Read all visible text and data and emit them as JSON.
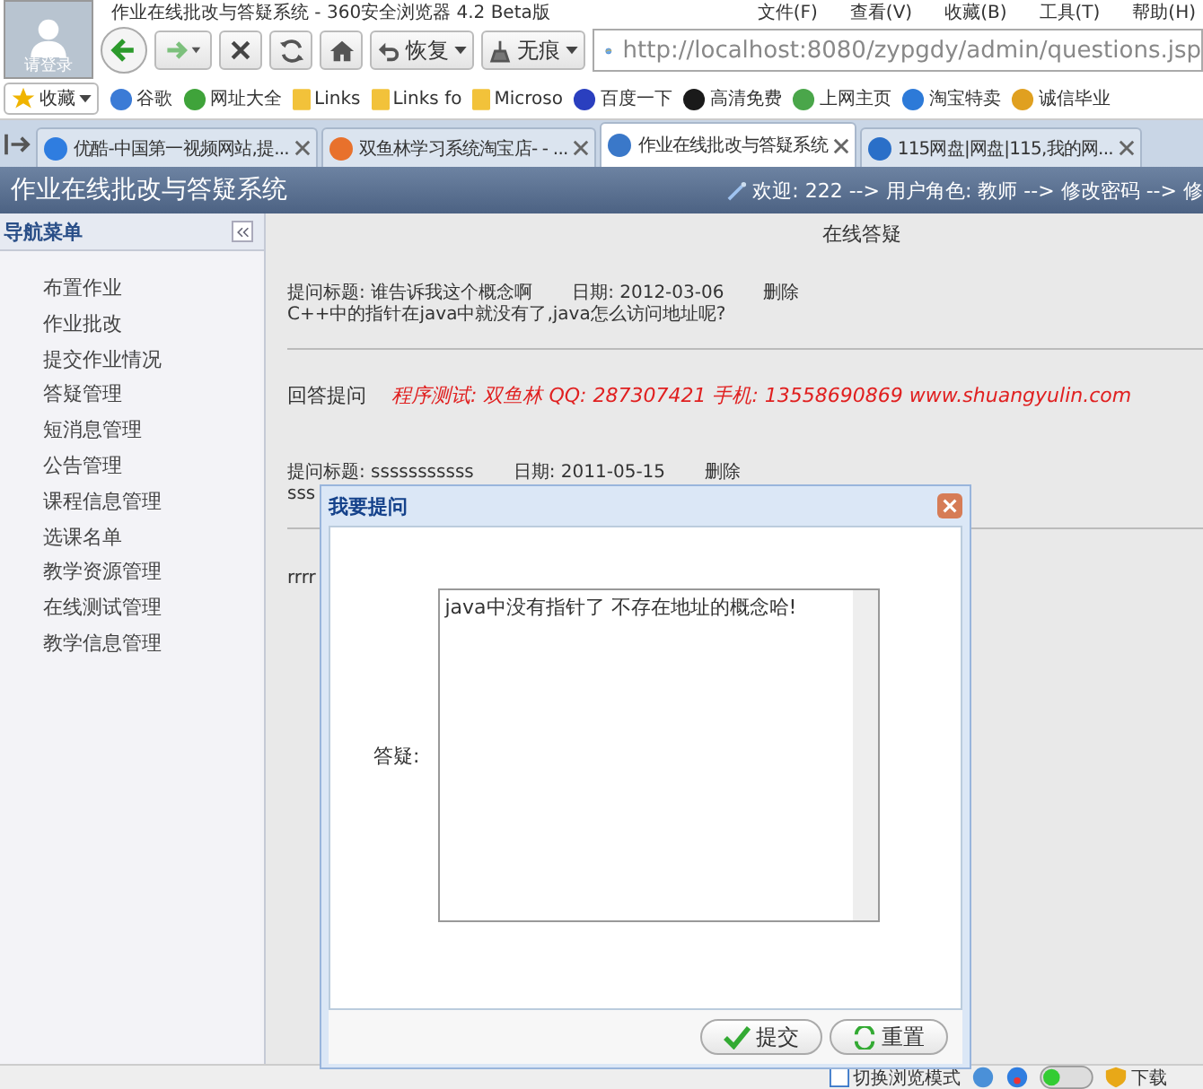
{
  "browser": {
    "login_label": "请登录",
    "title": "作业在线批改与答疑系统 - 360安全浏览器 4.2 Beta版",
    "menu": [
      "文件(F)",
      "查看(V)",
      "收藏(B)",
      "工具(T)",
      "帮助(H)"
    ],
    "nav_buttons": [
      {
        "label": "恢复",
        "kind": "restore"
      },
      {
        "label": "无痕",
        "kind": "private"
      }
    ],
    "address": "http://localhost:8080/zypgdy/admin/questions.jsp",
    "favorites_label": "收藏",
    "bookmarks": [
      {
        "label": "谷歌",
        "kind": "site",
        "color": "#3b7bd6"
      },
      {
        "label": "网址大全",
        "kind": "site",
        "color": "#3fa33a"
      },
      {
        "label": "Links",
        "kind": "folder",
        "color": "#f2c23a"
      },
      {
        "label": "Links fo",
        "kind": "folder",
        "color": "#f2c23a"
      },
      {
        "label": "Microso",
        "kind": "folder",
        "color": "#f2c23a"
      },
      {
        "label": "百度一下",
        "kind": "site",
        "color": "#2a3fbf"
      },
      {
        "label": "高清免费",
        "kind": "site",
        "color": "#1a1a1a"
      },
      {
        "label": "上网主页",
        "kind": "site",
        "color": "#4aa64a"
      },
      {
        "label": "淘宝特卖",
        "kind": "site",
        "color": "#2d7ad8"
      },
      {
        "label": "诚信毕业",
        "kind": "site",
        "color": "#e0a020"
      }
    ],
    "tabs": [
      {
        "label": "优酷-中国第一视频网站,提...",
        "selected": false,
        "color": "#2f7de0"
      },
      {
        "label": "双鱼林学习系统淘宝店- - ...",
        "selected": false,
        "color": "#e8712c"
      },
      {
        "label": "作业在线批改与答疑系统",
        "selected": true,
        "color": "#3a78c9"
      },
      {
        "label": "115网盘|网盘|115,我的网...",
        "selected": false,
        "color": "#2a6fc8"
      }
    ],
    "status_bar": {
      "mode_label": "切换浏览模式",
      "download_label": "下载"
    }
  },
  "app": {
    "title": "作业在线批改与答疑系统",
    "user_info": "欢迎: 222 --> 用户角色: 教师 --> 修改密码 --> 修",
    "sidebar": {
      "title": "导航菜单",
      "items": [
        "布置作业",
        "作业批改",
        "提交作业情况",
        "答疑管理",
        "短消息管理",
        "公告管理",
        "课程信息管理",
        "选课名单",
        "教学资源管理",
        "在线测试管理",
        "教学信息管理"
      ]
    },
    "page_title": "在线答疑",
    "questions": [
      {
        "title_line": "提问标题: 谁告诉我这个概念啊",
        "date": "日期: 2012-03-06",
        "delete": "删除",
        "content": "C++中的指针在java中就没有了,java怎么访问地址呢?"
      },
      {
        "title_line": "提问标题: sssssssssss",
        "date": "日期: 2011-05-15",
        "delete": "删除",
        "content": "sss"
      }
    ],
    "answer_label": "回答提问",
    "promo": "程序测试: 双鱼林  QQ: 287307421  手机: 13558690869  www.shuangyulin.com",
    "answer_text": "rrrr"
  },
  "dialog": {
    "title": "我要提问",
    "field_label": "答疑:",
    "value": "java中没有指针了 不存在地址的概念哈!",
    "buttons": [
      {
        "label": "提交",
        "kind": "submit"
      },
      {
        "label": "重置",
        "kind": "reset"
      }
    ]
  }
}
